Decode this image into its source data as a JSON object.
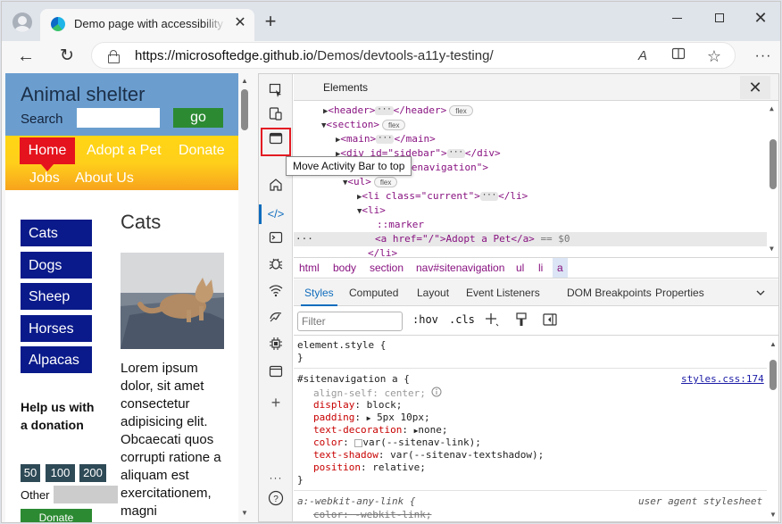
{
  "browser": {
    "tab_title": "Demo page with accessibility issues",
    "tab_close": "✕",
    "new_tab": "+",
    "url_host": "https://microsoftedge.github.io",
    "url_path": "/Demos/devtools-a11y-testing/",
    "read_aloud": "A",
    "more": "···"
  },
  "page": {
    "site_title": "Animal shelter",
    "search_label": "Search",
    "go_label": "go",
    "nav": {
      "home": "Home",
      "adopt": "Adopt a Pet",
      "donate": "Donate",
      "jobs": "Jobs",
      "about": "About Us"
    },
    "sidebar": [
      "Cats",
      "Dogs",
      "Sheep",
      "Horses",
      "Alpacas"
    ],
    "help_text": "Help us with a donation",
    "amounts": [
      "50",
      "100",
      "200"
    ],
    "other_label": "Other",
    "donate_btn": "Donate",
    "heading": "Cats",
    "lorem": "Lorem ipsum dolor, sit amet consectetur adipisicing elit. Obcaecati quos corrupti ratione a aliquam est exercitationem, magni"
  },
  "devtools": {
    "panel_title": "Elements",
    "close": "✕",
    "tooltip": "Move Activity Bar to top",
    "dom": {
      "header_open": "<header>",
      "header_close": "</header>",
      "section_open": "<section>",
      "main_open": "<main>",
      "main_close": "</main>",
      "sidebar_tag": "<div id=\"sidebar\">",
      "sidebar_close": "</div>",
      "nav_tag": "<nav id=\"sitenavigation\">",
      "ul_open": "<ul>",
      "li_current": "<li class=\"current\">",
      "li_current_close": "</li>",
      "li_open": "<li>",
      "marker": "::marker",
      "a_line": "<a href=\"/\">Adopt a Pet</a>",
      "dollar0": "== $0",
      "li_close": "</li>",
      "flex": "flex",
      "ellipsis": "···",
      "gutter_dots": "···"
    },
    "breadcrumbs": [
      "html",
      "body",
      "section",
      "nav#sitenavigation",
      "ul",
      "li",
      "a"
    ],
    "tabs": [
      "Styles",
      "Computed",
      "Layout",
      "Event Listeners",
      "DOM Breakpoints",
      "Properties"
    ],
    "filter_placeholder": "Filter",
    "hov": ":hov",
    "cls": ".cls",
    "styles": {
      "element_style": "element.style {",
      "brace_close": "}",
      "rule_selector": "#sitenavigation a {",
      "rule_source": "styles.css:174",
      "props": [
        {
          "name": "align-self",
          "value": "center;",
          "faded": true
        },
        {
          "name": "display",
          "value": "block;"
        },
        {
          "name": "padding",
          "value": "5px 10px;"
        },
        {
          "name": "text-decoration",
          "value": "none;"
        },
        {
          "name": "color",
          "value": "var(--sitenav-link);"
        },
        {
          "name": "text-shadow",
          "value": "var(--sitenav-textshadow);"
        },
        {
          "name": "position",
          "value": "relative;"
        }
      ],
      "ua_selector": "a:-webkit-any-link {",
      "ua_label": "user agent stylesheet",
      "ua_prop": "color: -webkit-link;"
    }
  }
}
